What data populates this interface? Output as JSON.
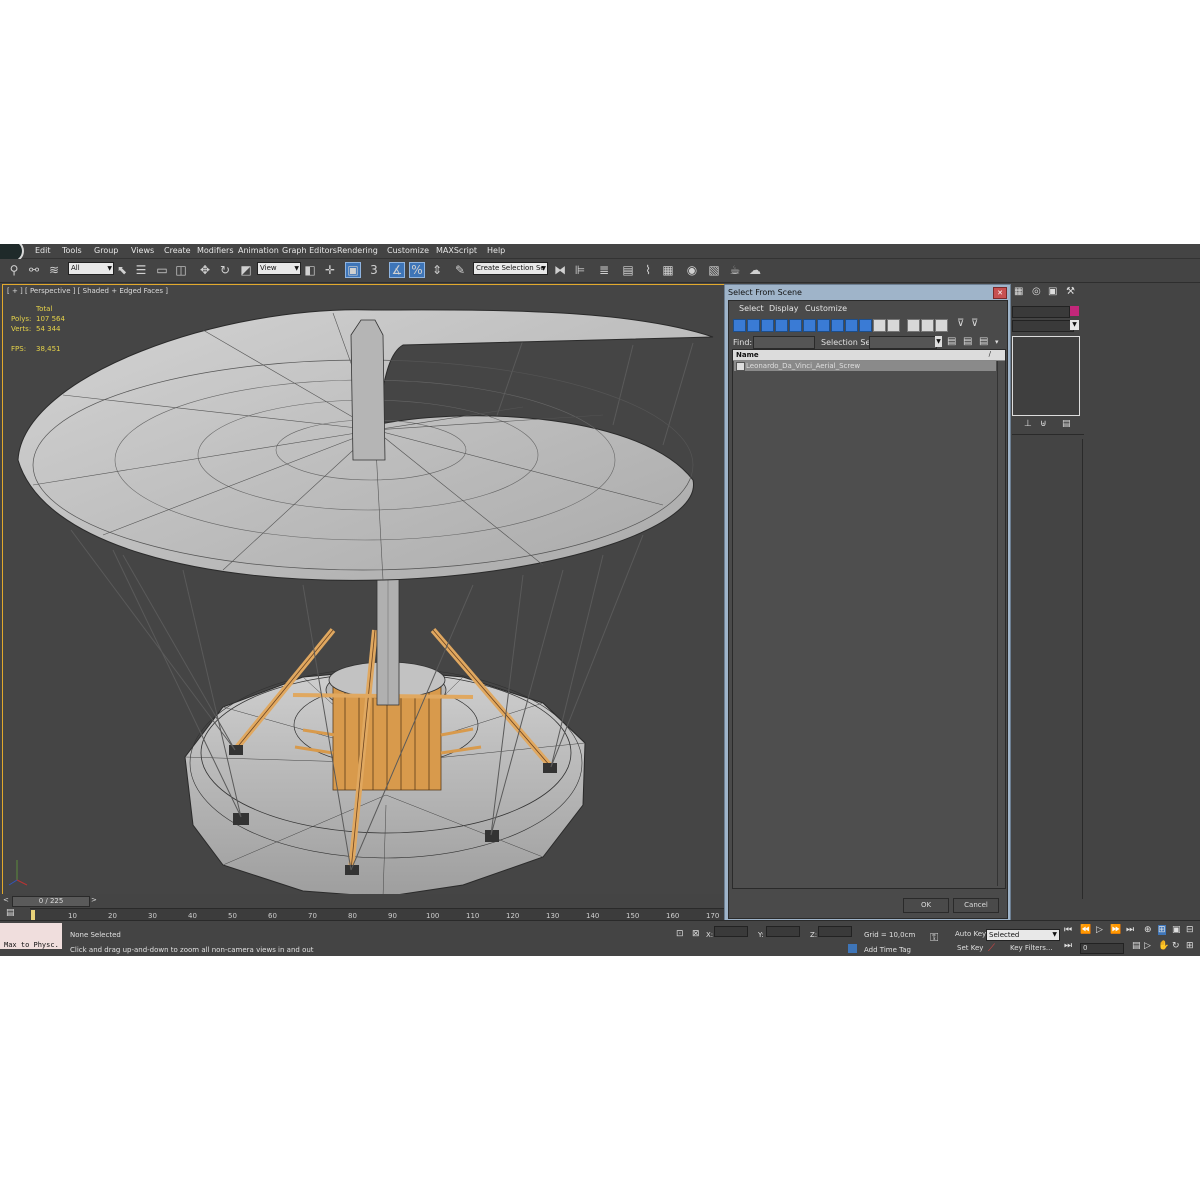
{
  "menubar": {
    "items": [
      "Edit",
      "Tools",
      "Group",
      "Views",
      "Create",
      "Modifiers",
      "Animation",
      "Graph Editors",
      "Rendering",
      "Customize",
      "MAXScript",
      "Help"
    ]
  },
  "toolbar": {
    "filter_dropdown": "All",
    "coord_dropdown": "View",
    "snap_value": "3",
    "selection_set_dropdown": "Create Selection Se"
  },
  "viewport": {
    "label": "[ + ] [ Perspective ] [ Shaded + Edged Faces ]",
    "stats": {
      "total_label": "Total",
      "polys_label": "Polys:",
      "polys_value": "107 564",
      "verts_label": "Verts:",
      "verts_value": "54 344",
      "fps_label": "FPS:",
      "fps_value": "38,451"
    },
    "axis": {
      "x": "x",
      "y": "y",
      "z": "z"
    }
  },
  "dialog": {
    "title": "Select From Scene",
    "menu": [
      "Select",
      "Display",
      "Customize"
    ],
    "find_label": "Find:",
    "selection_set_label": "Selection Set:",
    "column_header": "Name",
    "objects": [
      "Leonardo_Da_Vinci_Aerial_Screw"
    ],
    "ok_label": "OK",
    "cancel_label": "Cancel"
  },
  "timeline": {
    "frame_counter": "0 / 225",
    "prev_arrow": "<",
    "next_arrow": ">",
    "ticks": [
      "10",
      "20",
      "30",
      "40",
      "50",
      "60",
      "70",
      "80",
      "90",
      "100",
      "110",
      "120",
      "130",
      "140",
      "150",
      "160",
      "170"
    ]
  },
  "status": {
    "mini_listener": "Max to Physc.",
    "selection_status": "None Selected",
    "prompt": "Click and drag up-and-down to zoom all non-camera views in and out",
    "x_label": "X:",
    "y_label": "Y:",
    "z_label": "Z:",
    "grid": "Grid = 10,0cm",
    "add_time_tag": "Add Time Tag",
    "auto_key": "Auto Key",
    "set_key": "Set Key",
    "key_mode_dropdown": "Selected",
    "key_filters": "Key Filters...",
    "current_frame": "0"
  },
  "colors": {
    "viewport_border": "#e2a92c",
    "stats_text": "#e5d24a",
    "active_tool": "#3e75b8",
    "wood": "#d89a4c",
    "mesh": "#bdbdbd"
  }
}
